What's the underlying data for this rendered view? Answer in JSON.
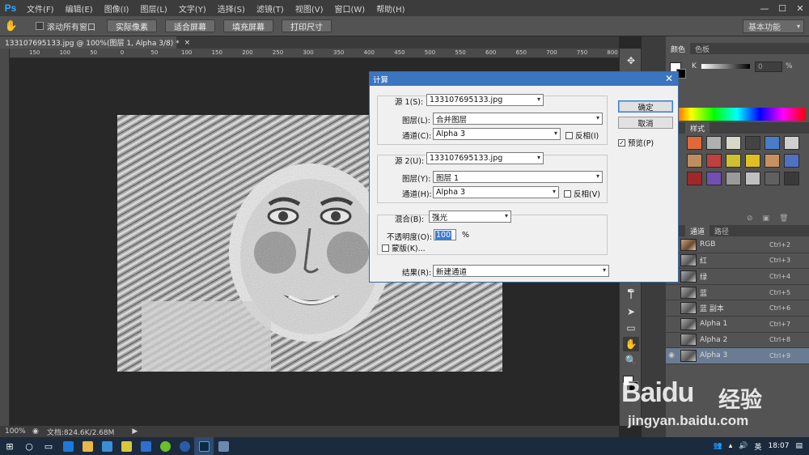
{
  "app": {
    "logo": "Ps",
    "menu": [
      "文件(F)",
      "编辑(E)",
      "图像(I)",
      "图层(L)",
      "文字(Y)",
      "选择(S)",
      "滤镜(T)",
      "视图(V)",
      "窗口(W)",
      "帮助(H)"
    ],
    "window_controls": [
      "—",
      "☐",
      "✕"
    ]
  },
  "options_bar": {
    "scroll_all_label": "滚动所有窗口",
    "buttons": [
      "实际像素",
      "适合屏幕",
      "填充屏幕",
      "打印尺寸"
    ],
    "workspace": "基本功能"
  },
  "document": {
    "tab_title": "133107695133.jpg @ 100%(图层 1, Alpha 3/8) *",
    "tab_close": "×",
    "ruler_ticks": [
      "150",
      "100",
      "50",
      "0",
      "50",
      "100",
      "150",
      "200",
      "250",
      "300",
      "350",
      "400",
      "450",
      "500",
      "550",
      "600",
      "650",
      "700",
      "750",
      "800"
    ],
    "zoom": "100%",
    "doc_info": "文档:824.6K/2.68M"
  },
  "color_panel": {
    "tabs": [
      "颜色",
      "色板"
    ],
    "k_label": "K",
    "k_value": "0",
    "k_unit": "%"
  },
  "styles_panel": {
    "tabs": [
      "样式"
    ],
    "swatch_colors": [
      "#e0683a",
      "#b0b0b0",
      "#d8d8c8",
      "#444444",
      "#4a7cc8",
      "#cfcfcf",
      "#c08d5e",
      "#c04040",
      "#cfc030",
      "#e0c020",
      "#c89060",
      "#5070c0",
      "#a02828",
      "#7050b0",
      "#9a9a9a",
      "#c0c0c0",
      "#606060",
      "#3a3a3a"
    ]
  },
  "channels_panel": {
    "tabs": [
      "通道",
      "路径"
    ],
    "rows": [
      {
        "name": "RGB",
        "key": "Ctrl+2",
        "eye": "",
        "thumb": "color"
      },
      {
        "name": "红",
        "key": "Ctrl+3",
        "eye": "",
        "thumb": "gray"
      },
      {
        "name": "绿",
        "key": "Ctrl+4",
        "eye": "",
        "thumb": "gray"
      },
      {
        "name": "蓝",
        "key": "Ctrl+5",
        "eye": "",
        "thumb": "gray"
      },
      {
        "name": "蓝 副本",
        "key": "Ctrl+6",
        "eye": "",
        "thumb": "gray"
      },
      {
        "name": "Alpha 1",
        "key": "Ctrl+7",
        "eye": "",
        "thumb": "gray"
      },
      {
        "name": "Alpha 2",
        "key": "Ctrl+8",
        "eye": "",
        "thumb": "gray"
      },
      {
        "name": "Alpha 3",
        "key": "Ctrl+9",
        "eye": "◉",
        "thumb": "gray",
        "selected": true
      }
    ]
  },
  "dialog": {
    "title": "计算",
    "close": "✕",
    "source1": {
      "label": "源 1(S):",
      "file": "133107695133.jpg",
      "layer_label": "图层(L):",
      "layer": "合并图层",
      "channel_label": "通道(C):",
      "channel": "Alpha 3",
      "invert_label": "反相(I)"
    },
    "source2": {
      "label": "源 2(U):",
      "file": "133107695133.jpg",
      "layer_label": "图层(Y):",
      "layer": "图层 1",
      "channel_label": "通道(H):",
      "channel": "Alpha 3",
      "invert_label": "反相(V)"
    },
    "blend_label": "混合(B):",
    "blend": "强光",
    "opacity_label": "不透明度(O):",
    "opacity": "100",
    "opacity_unit": "%",
    "mask_label": "蒙版(K)...",
    "result_label": "结果(R):",
    "result": "新建通道",
    "ok": "确定",
    "cancel": "取消",
    "preview_label": "预览(P)",
    "preview_checked": "✓"
  },
  "taskbar": {
    "tray_text": [
      "英"
    ],
    "time": "18:07"
  },
  "watermark": {
    "main": "Baidu",
    "cn": "经验",
    "url": "jingyan.baidu.com"
  }
}
